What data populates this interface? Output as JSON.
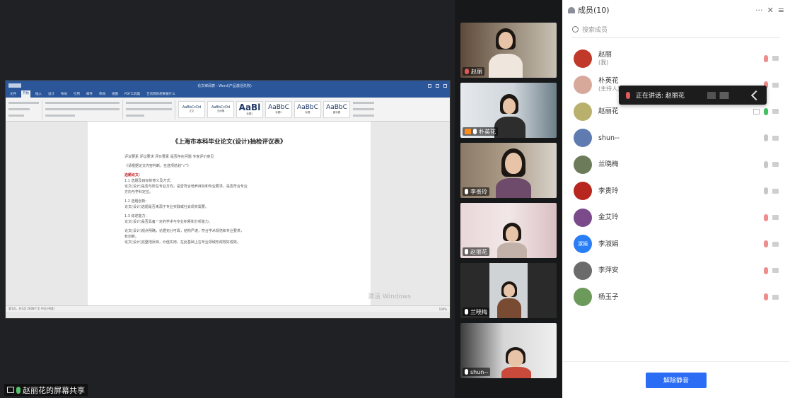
{
  "share": {
    "label": "赵丽花的屏幕共享",
    "word": {
      "title": "论文审阅表 - Word(产品激活失败)",
      "tabs": [
        "文件",
        "开始",
        "插入",
        "设计",
        "布局",
        "引用",
        "邮件",
        "审阅",
        "视图",
        "PDF工具集",
        "告诉我你想要做什么"
      ],
      "heading": "《上海市本科毕业论文(设计)抽检评议表》",
      "lines": [
        "评议要素    评议要求    评价要素    是否存在问题    专家评价意见",
        "《请根据论文内容判断，在选项前划“√”》",
        "选题论文：",
        "1.1 选题及目标的意义及方式：",
        "论文(设计)是否与所在专业方向，是否符合培养目标和专业要求，是否符合专业",
        "方向与学科定位。",
        "1.2 选题创新：",
        "论文(设计)选题是否来源于专业实践或社会现实需要。",
        "1.3 综述能力：",
        "论文(设计)是否具备一定的学术与专业积累和分析能力。",
        "论文(设计)观点明确，论据充分可靠，结构严谨，符合学术规范和专业要求，",
        "有创新。",
        "论文(设计)完整地反映，价值实用，在此基础上在专业领域形成较好成效。"
      ],
      "styles": [
        "AaBbCcDd",
        "AaBbCcDd",
        "AaBl",
        "AaBbC",
        "AaBbC",
        "AaBbC"
      ],
      "style_names": [
        "正文",
        "无间隔",
        "标题1",
        "标题2",
        "标题",
        "副标题"
      ],
      "status_left": "第1页，共1页  2008个字  中文(中国)",
      "status_right": "100%",
      "watermark": "激活 Windows"
    }
  },
  "videos": [
    {
      "name": "赵丽",
      "mic": "off"
    },
    {
      "name": "朴英花",
      "mic": "on",
      "camera": true
    },
    {
      "name": "李贵玲",
      "mic": "on"
    },
    {
      "name": "赵丽花",
      "mic": "on"
    },
    {
      "name": "兰晓梅",
      "mic": "on"
    },
    {
      "name": "shun--",
      "mic": "on"
    }
  ],
  "panel": {
    "title": "成员(10)",
    "controls": {
      "more": "···",
      "close": "✕",
      "menu": "≡"
    },
    "search_placeholder": "搜索成员",
    "members": [
      {
        "name": "赵丽",
        "sub": "(我)",
        "mic": "off",
        "avatar_color": "#c0392b",
        "avatar_text": ""
      },
      {
        "name": "朴英花",
        "sub": "(主持人)",
        "mic": "off",
        "avatar_color": "#d7a99b",
        "avatar_text": ""
      },
      {
        "name": "赵丽花",
        "sub": "",
        "mic": "on",
        "avatar_color": "#b8b06c",
        "avatar_text": ""
      },
      {
        "name": "shun--",
        "sub": "",
        "mic": "idle",
        "avatar_color": "#5f7bb0",
        "avatar_text": ""
      },
      {
        "name": "兰晓梅",
        "sub": "",
        "mic": "idle",
        "avatar_color": "#6c7b59",
        "avatar_text": ""
      },
      {
        "name": "李贵玲",
        "sub": "",
        "mic": "idle",
        "avatar_color": "#b7271f",
        "avatar_text": ""
      },
      {
        "name": "金艾玲",
        "sub": "",
        "mic": "off",
        "avatar_color": "#7a4a8a",
        "avatar_text": ""
      },
      {
        "name": "李淑娟",
        "sub": "",
        "mic": "off",
        "avatar_color": "#2a7ef5",
        "avatar_text": "淑娟"
      },
      {
        "name": "李萍安",
        "sub": "",
        "mic": "off",
        "avatar_color": "#6b6b6b",
        "avatar_text": ""
      },
      {
        "name": "杨玉子",
        "sub": "",
        "mic": "off",
        "avatar_color": "#6b9a5a",
        "avatar_text": ""
      }
    ],
    "speaking_text": "正在讲话: 赵丽花",
    "mute_all_label": "解除静音"
  }
}
